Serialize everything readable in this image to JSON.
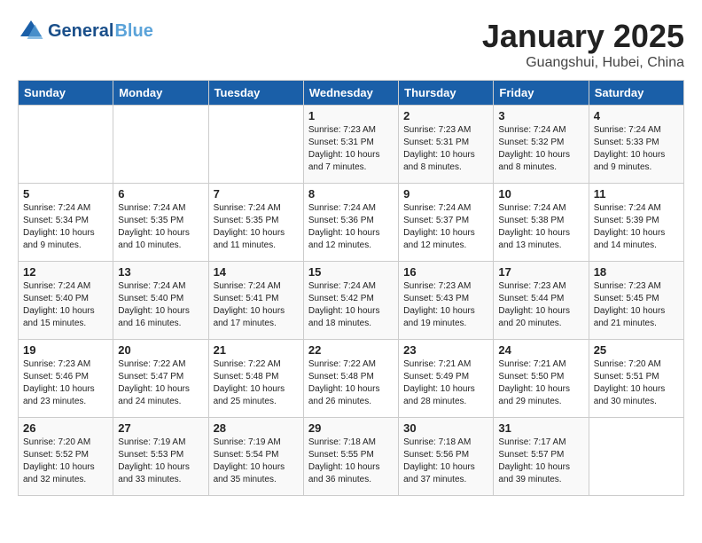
{
  "header": {
    "logo_line1": "General",
    "logo_line2": "Blue",
    "title": "January 2025",
    "subtitle": "Guangshui, Hubei, China"
  },
  "days_of_week": [
    "Sunday",
    "Monday",
    "Tuesday",
    "Wednesday",
    "Thursday",
    "Friday",
    "Saturday"
  ],
  "weeks": [
    [
      {
        "day": "",
        "info": ""
      },
      {
        "day": "",
        "info": ""
      },
      {
        "day": "",
        "info": ""
      },
      {
        "day": "1",
        "info": "Sunrise: 7:23 AM\nSunset: 5:31 PM\nDaylight: 10 hours\nand 7 minutes."
      },
      {
        "day": "2",
        "info": "Sunrise: 7:23 AM\nSunset: 5:31 PM\nDaylight: 10 hours\nand 8 minutes."
      },
      {
        "day": "3",
        "info": "Sunrise: 7:24 AM\nSunset: 5:32 PM\nDaylight: 10 hours\nand 8 minutes."
      },
      {
        "day": "4",
        "info": "Sunrise: 7:24 AM\nSunset: 5:33 PM\nDaylight: 10 hours\nand 9 minutes."
      }
    ],
    [
      {
        "day": "5",
        "info": "Sunrise: 7:24 AM\nSunset: 5:34 PM\nDaylight: 10 hours\nand 9 minutes."
      },
      {
        "day": "6",
        "info": "Sunrise: 7:24 AM\nSunset: 5:35 PM\nDaylight: 10 hours\nand 10 minutes."
      },
      {
        "day": "7",
        "info": "Sunrise: 7:24 AM\nSunset: 5:35 PM\nDaylight: 10 hours\nand 11 minutes."
      },
      {
        "day": "8",
        "info": "Sunrise: 7:24 AM\nSunset: 5:36 PM\nDaylight: 10 hours\nand 12 minutes."
      },
      {
        "day": "9",
        "info": "Sunrise: 7:24 AM\nSunset: 5:37 PM\nDaylight: 10 hours\nand 12 minutes."
      },
      {
        "day": "10",
        "info": "Sunrise: 7:24 AM\nSunset: 5:38 PM\nDaylight: 10 hours\nand 13 minutes."
      },
      {
        "day": "11",
        "info": "Sunrise: 7:24 AM\nSunset: 5:39 PM\nDaylight: 10 hours\nand 14 minutes."
      }
    ],
    [
      {
        "day": "12",
        "info": "Sunrise: 7:24 AM\nSunset: 5:40 PM\nDaylight: 10 hours\nand 15 minutes."
      },
      {
        "day": "13",
        "info": "Sunrise: 7:24 AM\nSunset: 5:40 PM\nDaylight: 10 hours\nand 16 minutes."
      },
      {
        "day": "14",
        "info": "Sunrise: 7:24 AM\nSunset: 5:41 PM\nDaylight: 10 hours\nand 17 minutes."
      },
      {
        "day": "15",
        "info": "Sunrise: 7:24 AM\nSunset: 5:42 PM\nDaylight: 10 hours\nand 18 minutes."
      },
      {
        "day": "16",
        "info": "Sunrise: 7:23 AM\nSunset: 5:43 PM\nDaylight: 10 hours\nand 19 minutes."
      },
      {
        "day": "17",
        "info": "Sunrise: 7:23 AM\nSunset: 5:44 PM\nDaylight: 10 hours\nand 20 minutes."
      },
      {
        "day": "18",
        "info": "Sunrise: 7:23 AM\nSunset: 5:45 PM\nDaylight: 10 hours\nand 21 minutes."
      }
    ],
    [
      {
        "day": "19",
        "info": "Sunrise: 7:23 AM\nSunset: 5:46 PM\nDaylight: 10 hours\nand 23 minutes."
      },
      {
        "day": "20",
        "info": "Sunrise: 7:22 AM\nSunset: 5:47 PM\nDaylight: 10 hours\nand 24 minutes."
      },
      {
        "day": "21",
        "info": "Sunrise: 7:22 AM\nSunset: 5:48 PM\nDaylight: 10 hours\nand 25 minutes."
      },
      {
        "day": "22",
        "info": "Sunrise: 7:22 AM\nSunset: 5:48 PM\nDaylight: 10 hours\nand 26 minutes."
      },
      {
        "day": "23",
        "info": "Sunrise: 7:21 AM\nSunset: 5:49 PM\nDaylight: 10 hours\nand 28 minutes."
      },
      {
        "day": "24",
        "info": "Sunrise: 7:21 AM\nSunset: 5:50 PM\nDaylight: 10 hours\nand 29 minutes."
      },
      {
        "day": "25",
        "info": "Sunrise: 7:20 AM\nSunset: 5:51 PM\nDaylight: 10 hours\nand 30 minutes."
      }
    ],
    [
      {
        "day": "26",
        "info": "Sunrise: 7:20 AM\nSunset: 5:52 PM\nDaylight: 10 hours\nand 32 minutes."
      },
      {
        "day": "27",
        "info": "Sunrise: 7:19 AM\nSunset: 5:53 PM\nDaylight: 10 hours\nand 33 minutes."
      },
      {
        "day": "28",
        "info": "Sunrise: 7:19 AM\nSunset: 5:54 PM\nDaylight: 10 hours\nand 35 minutes."
      },
      {
        "day": "29",
        "info": "Sunrise: 7:18 AM\nSunset: 5:55 PM\nDaylight: 10 hours\nand 36 minutes."
      },
      {
        "day": "30",
        "info": "Sunrise: 7:18 AM\nSunset: 5:56 PM\nDaylight: 10 hours\nand 37 minutes."
      },
      {
        "day": "31",
        "info": "Sunrise: 7:17 AM\nSunset: 5:57 PM\nDaylight: 10 hours\nand 39 minutes."
      },
      {
        "day": "",
        "info": ""
      }
    ]
  ]
}
